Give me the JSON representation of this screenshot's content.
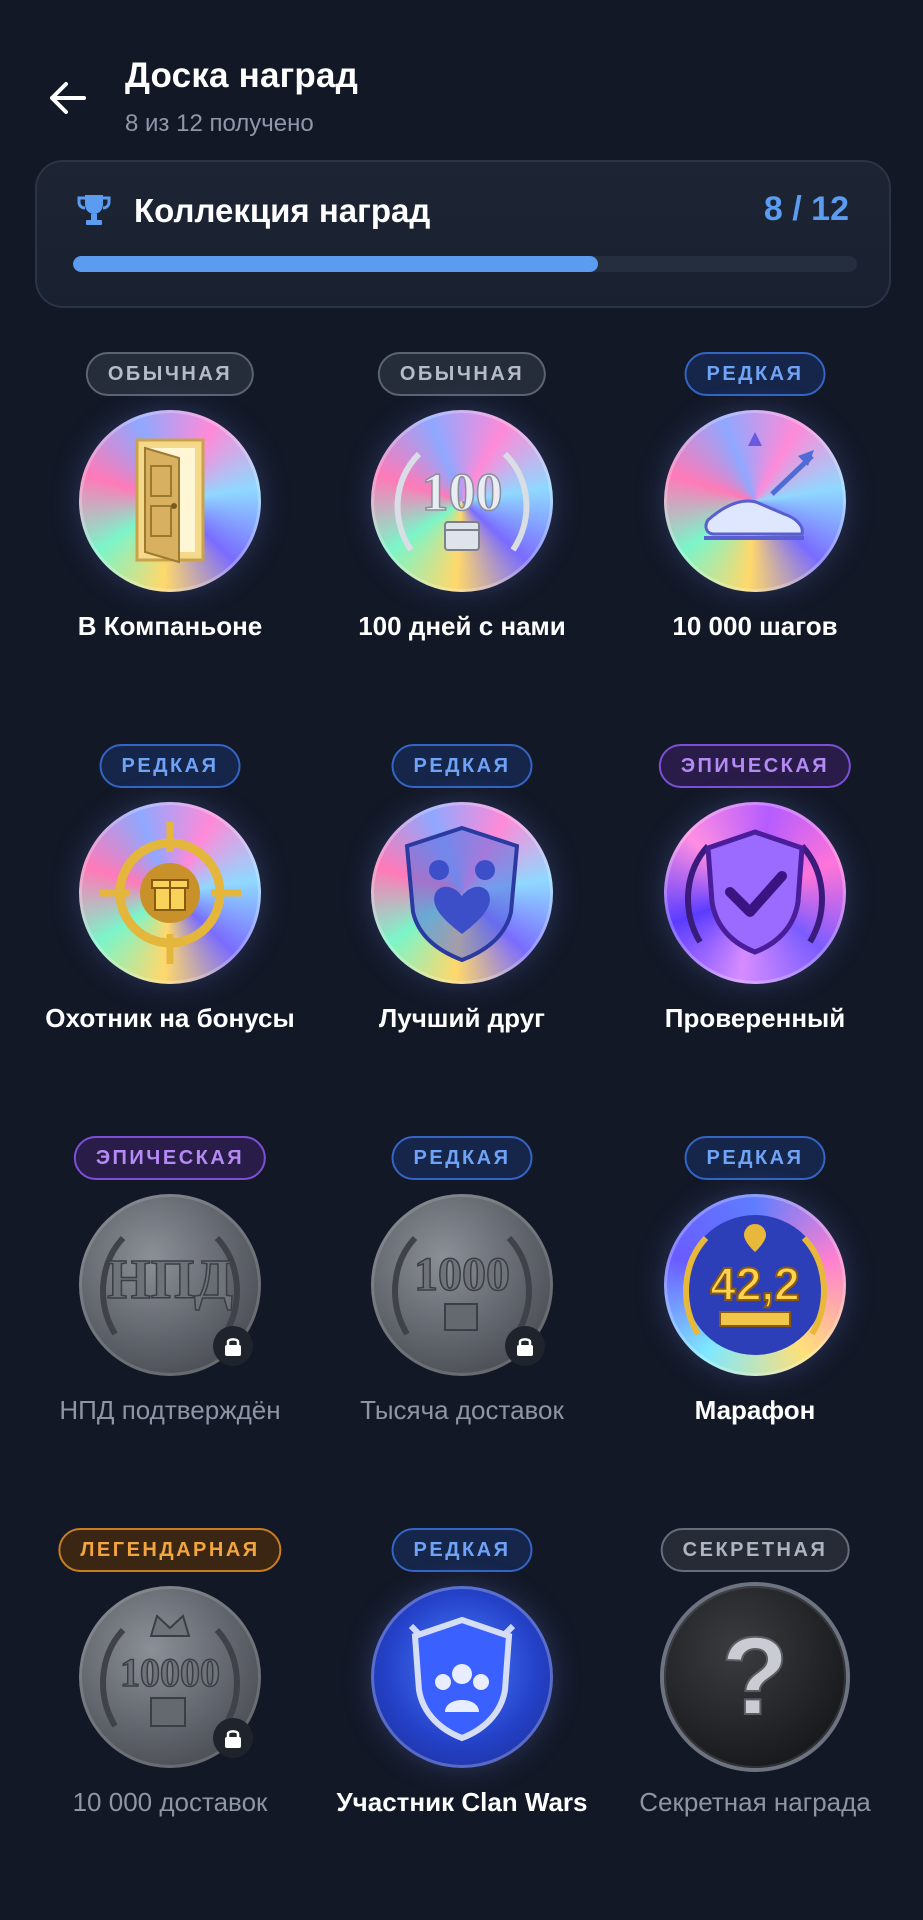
{
  "header": {
    "title": "Доска наград",
    "subtitle": "8 из 12 получено"
  },
  "collection": {
    "title": "Коллекция наград",
    "count": "8 / 12",
    "progress": 0.67
  },
  "colors": {
    "accent": "#5b9cf0",
    "background": "#121826",
    "card": "#1d2535"
  },
  "achievements": [
    {
      "rarity": "ОБЫЧНАЯ",
      "rarity_class": "common",
      "name": "В Компаньоне",
      "locked": false,
      "icon": "open-door-icon"
    },
    {
      "rarity": "ОБЫЧНАЯ",
      "rarity_class": "common",
      "name": "100 дней с нами",
      "locked": false,
      "icon": "calendar-100-icon",
      "medal_text": "100"
    },
    {
      "rarity": "РЕДКАЯ",
      "rarity_class": "rare",
      "name": "10 000 шагов",
      "locked": false,
      "icon": "sneaker-icon"
    },
    {
      "rarity": "РЕДКАЯ",
      "rarity_class": "rare",
      "name": "Охотник на бонусы",
      "locked": false,
      "icon": "target-gift-icon"
    },
    {
      "rarity": "РЕДКАЯ",
      "rarity_class": "rare",
      "name": "Лучший друг",
      "locked": false,
      "icon": "friendship-shield-icon"
    },
    {
      "rarity": "ЭПИЧЕСКАЯ",
      "rarity_class": "epic",
      "name": "Проверенный",
      "locked": false,
      "icon": "checkmark-shield-icon"
    },
    {
      "rarity": "ЭПИЧЕСКАЯ",
      "rarity_class": "epic",
      "name": "НПД подтверждён",
      "locked": true,
      "icon": "npd-icon",
      "medal_text": "НПД"
    },
    {
      "rarity": "РЕДКАЯ",
      "rarity_class": "rare",
      "name": "Тысяча доставок",
      "locked": true,
      "icon": "box-1000-icon",
      "medal_text": "1000"
    },
    {
      "rarity": "РЕДКАЯ",
      "rarity_class": "rare",
      "name": "Марафон",
      "locked": false,
      "icon": "marathon-icon",
      "medal_text": "42,2"
    },
    {
      "rarity": "ЛЕГЕНДАРНАЯ",
      "rarity_class": "legend",
      "name": "10 000 доставок",
      "locked": true,
      "icon": "crown-10000-icon",
      "medal_text": "10000"
    },
    {
      "rarity": "РЕДКАЯ",
      "rarity_class": "rare",
      "name": "Участник Clan Wars",
      "locked": false,
      "icon": "clan-shield-icon"
    },
    {
      "rarity": "СЕКРЕТНАЯ",
      "rarity_class": "secret",
      "name": "Секретная награда",
      "locked": true,
      "icon": "question-mark-icon",
      "medal_text": "?"
    }
  ]
}
